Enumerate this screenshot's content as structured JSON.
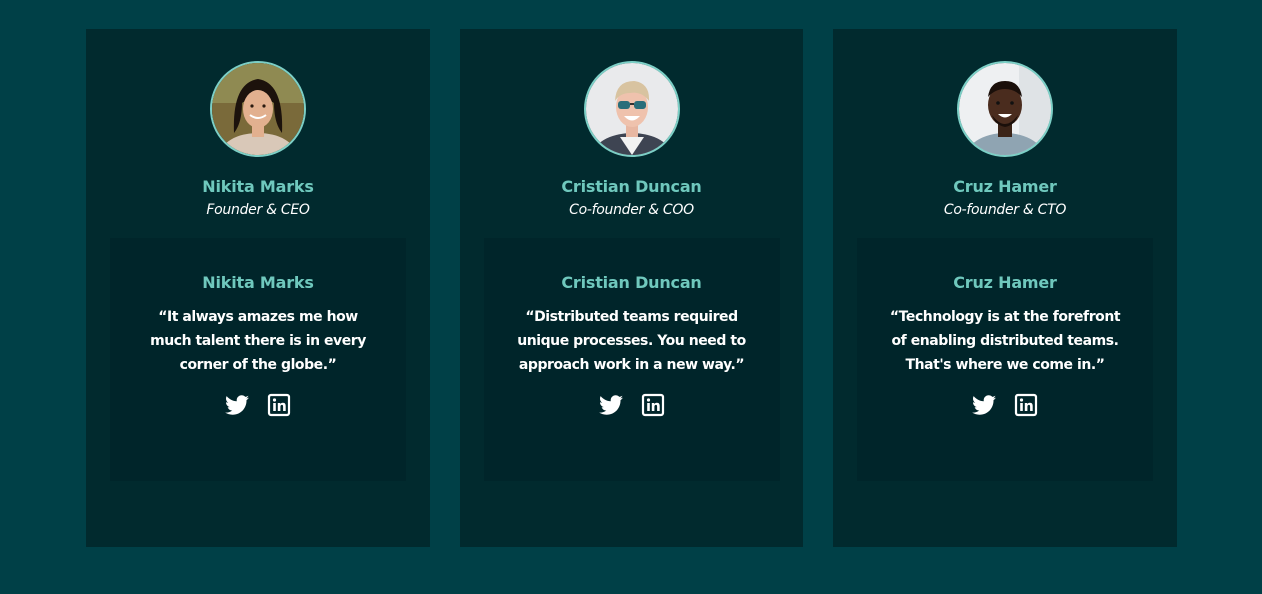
{
  "members": [
    {
      "name": "Nikita Marks",
      "role": "Founder & CEO",
      "quote_name": "Nikita Marks",
      "quote": "“It always amazes me how much talent there is in every corner of the globe.”",
      "avatar_icon": "portrait-woman-icon",
      "socials": [
        "twitter-icon",
        "linkedin-icon"
      ]
    },
    {
      "name": "Cristian Duncan",
      "role": "Co-founder & COO",
      "quote_name": "Cristian Duncan",
      "quote": "“Distributed teams required unique processes. You need to approach work in a new way.”",
      "avatar_icon": "portrait-man-sunglasses-icon",
      "socials": [
        "twitter-icon",
        "linkedin-icon"
      ]
    },
    {
      "name": "Cruz Hamer",
      "role": "Co-founder & CTO",
      "quote_name": "Cruz Hamer",
      "quote": "“Technology is at the forefront of enabling distributed teams. That's where we come in.”",
      "avatar_icon": "portrait-man-icon",
      "socials": [
        "twitter-icon",
        "linkedin-icon"
      ]
    }
  ],
  "colors": {
    "page_bg": "#004047",
    "card_bg": "#012a2e",
    "quote_bg": "#00252a",
    "accent": "#6fc8bd",
    "text": "#ffffff"
  }
}
